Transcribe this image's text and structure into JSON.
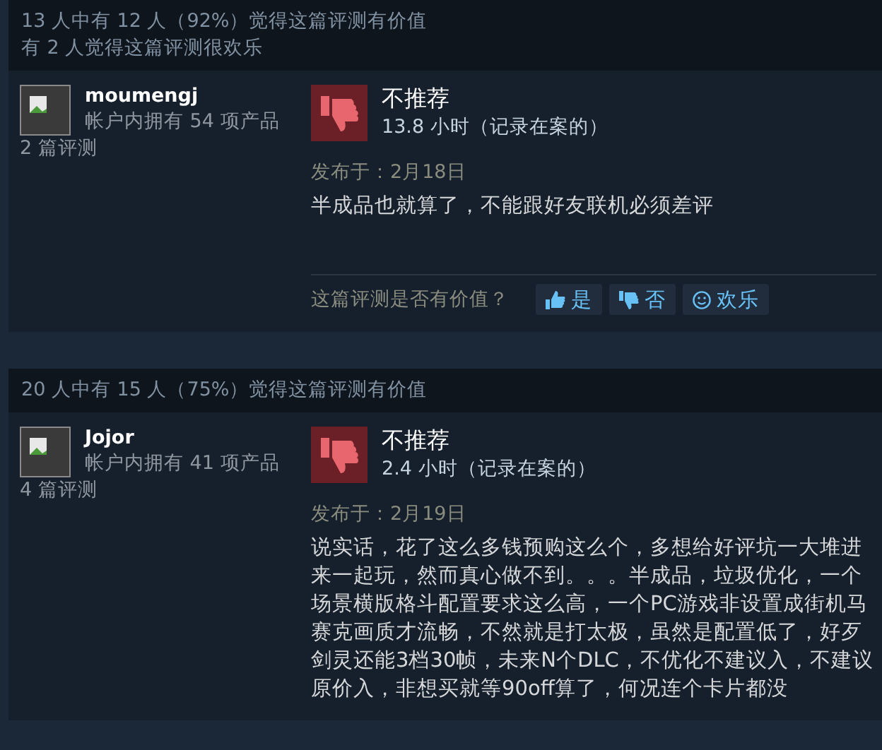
{
  "reviews": [
    {
      "helpful_lines": [
        "13 人中有 12 人（92%）觉得这篇评测有价值",
        "有 2 人觉得这篇评测很欢乐"
      ],
      "user": {
        "name": "moumengj",
        "products": "帐户内拥有 54 项产品",
        "review_count": "2 篇评测"
      },
      "recommended": false,
      "verdict": "不推荐",
      "hours": "13.8 小时（记录在案的）",
      "posted": "发布于：2月18日",
      "body": "半成品也就算了，不能跟好友联机必须差评",
      "vote": {
        "question": "这篇评测是否有价值？",
        "buttons": [
          {
            "kind": "yes",
            "label": "是"
          },
          {
            "kind": "no",
            "label": "否"
          },
          {
            "kind": "funny",
            "label": "欢乐"
          }
        ]
      }
    },
    {
      "helpful_lines": [
        "20 人中有 15 人（75%）觉得这篇评测有价值"
      ],
      "user": {
        "name": "Jojor",
        "products": "帐户内拥有 41 项产品",
        "review_count": "4 篇评测"
      },
      "recommended": false,
      "verdict": "不推荐",
      "hours": "2.4 小时（记录在案的）",
      "posted": "发布于：2月19日",
      "body": "说实话，花了这么多钱预购这么个，多想给好评坑一大堆进来一起玩，然而真心做不到。。。半成品，垃圾优化，一个场景横版格斗配置要求这么高，一个PC游戏非设置成街机马赛克画质才流畅，不然就是打太极，虽然是配置低了，好歹剑灵还能3档30帧，未来N个DLC，不优化不建议入，不建议原价入，非想买就等90off算了，何况连个卡片都没"
    }
  ]
}
